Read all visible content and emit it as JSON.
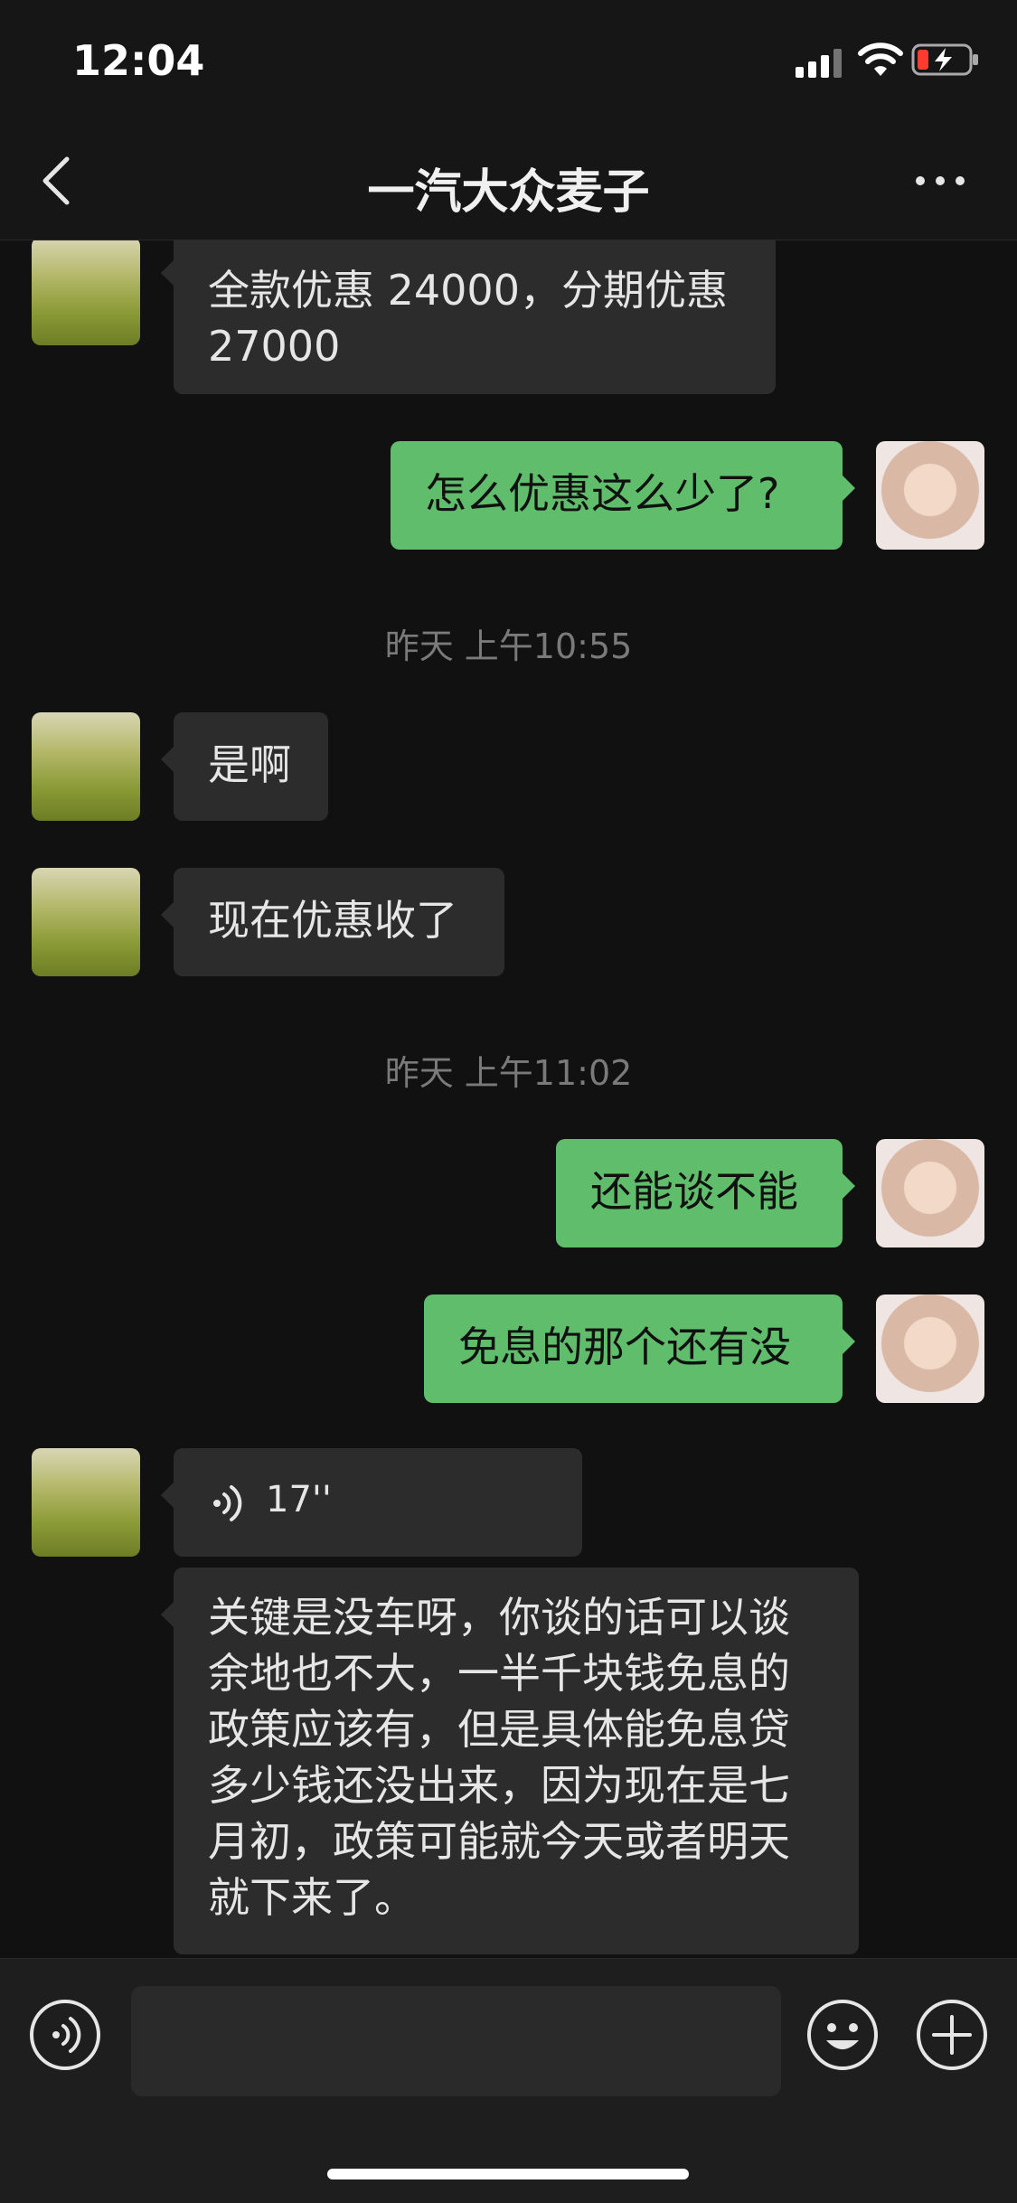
{
  "status_bar": {
    "time": "12:04"
  },
  "header": {
    "title": "一汽大众麦子"
  },
  "messages": [
    {
      "side": "in",
      "text": "全款优惠 24000，分期优惠\n27000"
    },
    {
      "side": "out",
      "text": "怎么优惠这么少了?"
    },
    {
      "type": "timestamp",
      "text": "昨天 上午10:55"
    },
    {
      "side": "in",
      "text": "是啊"
    },
    {
      "side": "in",
      "text": "现在优惠收了"
    },
    {
      "type": "timestamp",
      "text": "昨天 上午11:02"
    },
    {
      "side": "out",
      "text": "还能谈不能"
    },
    {
      "side": "out",
      "text": "免息的那个还有没"
    },
    {
      "side": "in",
      "type": "voice",
      "text": "17''"
    },
    {
      "side": "in",
      "text": "关键是没车呀，你谈的话可以谈余地也不大，一半千块钱免息的政策应该有，但是具体能免息贷多少钱还没出来，因为现在是七月初，政策可能就今天或者明天就下来了。"
    }
  ],
  "input": {
    "value": ""
  },
  "colors": {
    "background": "#111111",
    "incoming": "#2c2c2c",
    "outgoing": "#5fbd6c",
    "timestamp": "#7a7a7a"
  }
}
